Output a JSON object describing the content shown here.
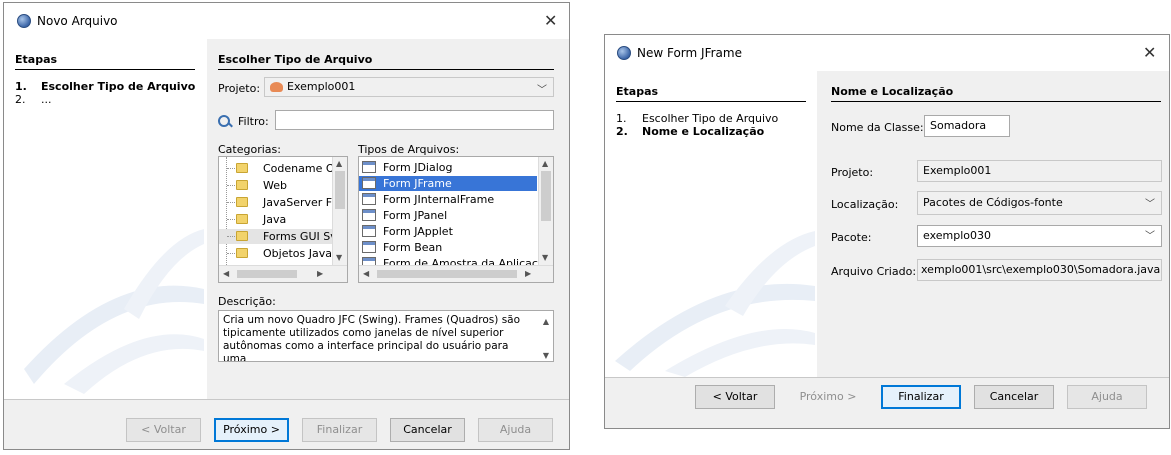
{
  "dialog1": {
    "title": "Novo Arquivo",
    "steps_heading": "Etapas",
    "steps": [
      {
        "num": "1.",
        "label": "Escolher Tipo de Arquivo"
      },
      {
        "num": "2.",
        "label": "..."
      }
    ],
    "panel_heading": "Escolher Tipo de Arquivo",
    "project_label": "Projeto:",
    "project_value": "Exemplo001",
    "filter_label": "Filtro:",
    "filter_value": "",
    "categories_label": "Categorias:",
    "categories": [
      "Codename O",
      "Web",
      "JavaServer F",
      "Java",
      "Forms GUI Sv",
      "Objetos Java"
    ],
    "categories_selected_index": 4,
    "file_types_label": "Tipos de Arquivos:",
    "file_types": [
      "Form JDialog",
      "Form JFrame",
      "Form JInternalFrame",
      "Form JPanel",
      "Form JApplet",
      "Form Bean",
      "Form de Amostra da Aplicação"
    ],
    "file_types_selected_index": 1,
    "description_label": "Descrição:",
    "description_lines": [
      "Cria um novo Quadro JFC (Swing). Frames (Quadros) são",
      "tipicamente utilizados como janelas de nível superior",
      "autônomas como a interface principal do usuário para uma"
    ],
    "buttons": {
      "back": "< Voltar",
      "next": "Próximo >",
      "finish": "Finalizar",
      "cancel": "Cancelar",
      "help": "Ajuda"
    }
  },
  "dialog2": {
    "title": "New Form JFrame",
    "steps_heading": "Etapas",
    "steps": [
      {
        "num": "1.",
        "label": "Escolher Tipo de Arquivo"
      },
      {
        "num": "2.",
        "label": "Nome e Localização"
      }
    ],
    "panel_heading": "Nome e Localização",
    "class_name_label": "Nome da Classe:",
    "class_name_value": "Somadora",
    "project_label": "Projeto:",
    "project_value": "Exemplo001",
    "location_label": "Localização:",
    "location_value": "Pacotes de Códigos-fonte",
    "package_label": "Pacote:",
    "package_value": "exemplo030",
    "created_file_label": "Arquivo Criado:",
    "created_file_value": "xemplo001\\src\\exemplo030\\Somadora.java",
    "buttons": {
      "back": "< Voltar",
      "next": "Próximo >",
      "finish": "Finalizar",
      "cancel": "Cancelar",
      "help": "Ajuda"
    }
  },
  "icons": {
    "close": "close-icon",
    "app": "java-cup-icon",
    "search": "search-icon",
    "folder": "folder-icon",
    "form": "form-icon",
    "project": "project-icon"
  },
  "colors": {
    "selection": "#3875d7",
    "primary_border": "#0078d7",
    "dialog_bg": "#f0f0f0"
  }
}
